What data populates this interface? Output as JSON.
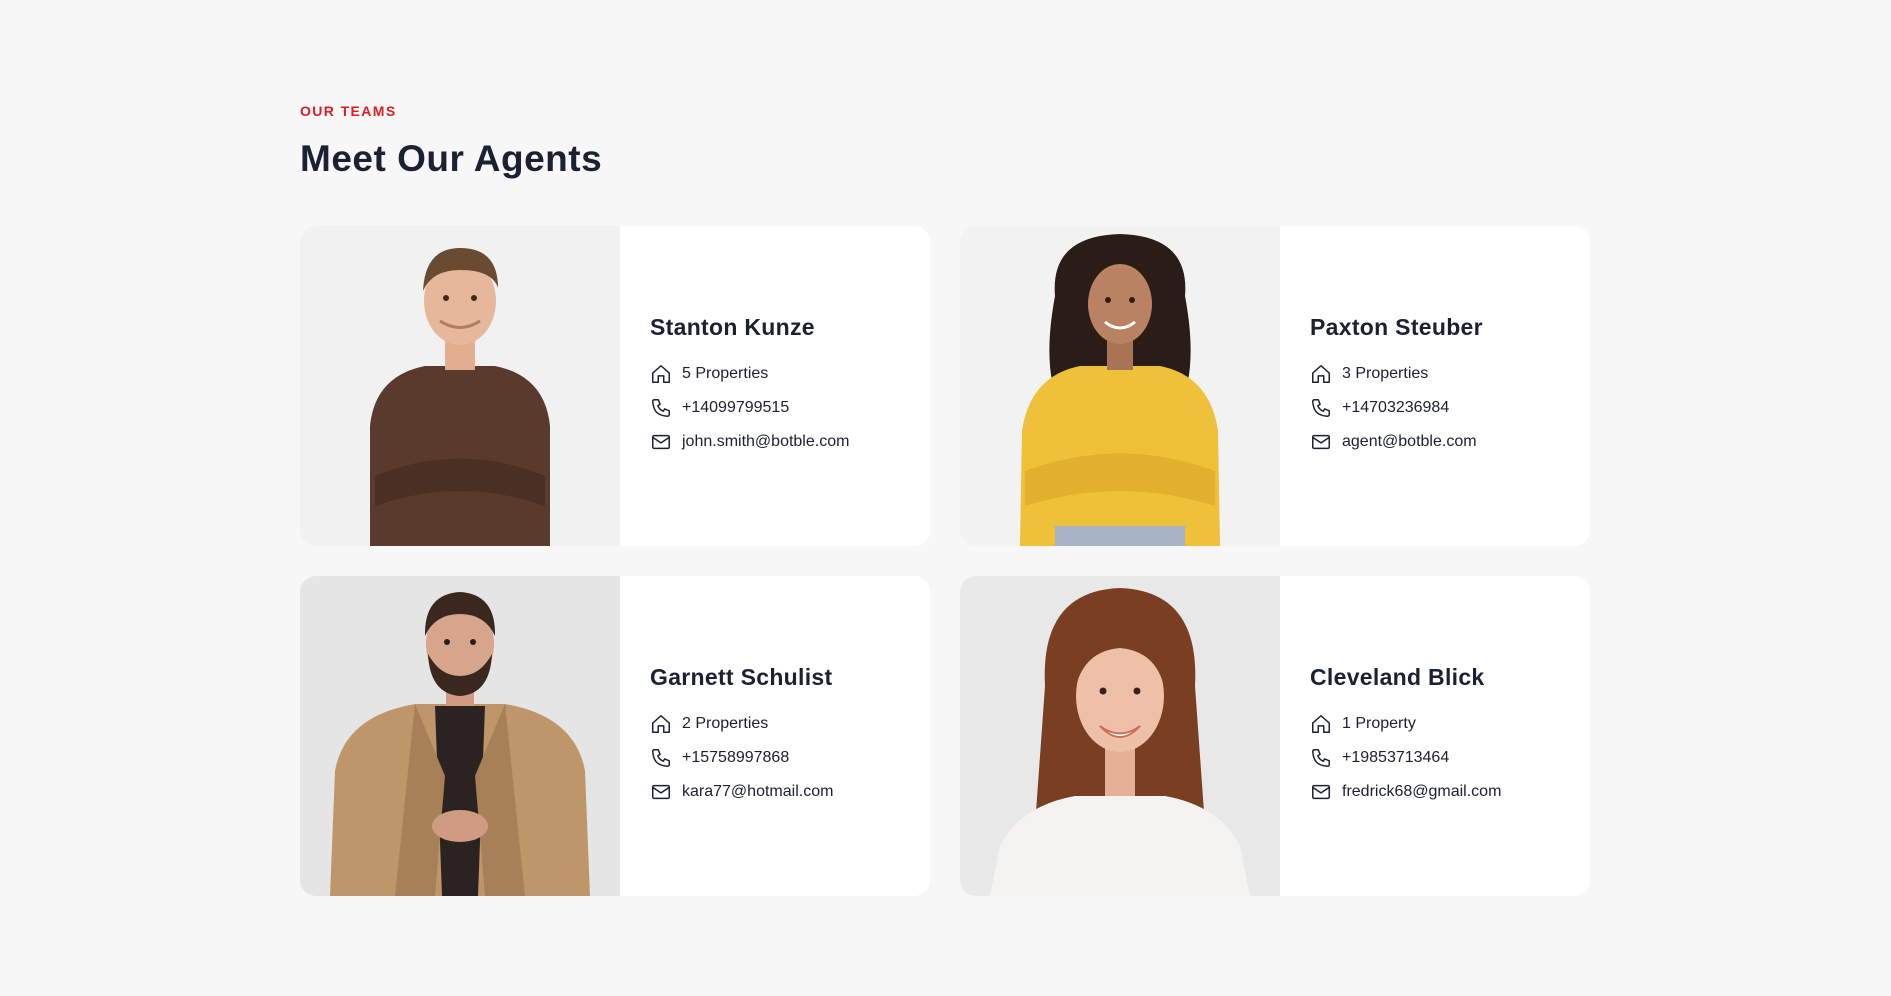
{
  "section": {
    "eyebrow": "OUR TEAMS",
    "title": "Meet Our Agents",
    "accent_color": "#db1d23",
    "text_color": "#1b2032"
  },
  "agents": [
    {
      "name": "Stanton Kunze",
      "properties": "5 Properties",
      "phone": "+14099799515",
      "email": "john.smith@botble.com",
      "photo_palette": {
        "bg": "#f1f1f1",
        "outfit": "#5a3a2c",
        "hair": "#6b4a32",
        "skin": "#e7b79c"
      }
    },
    {
      "name": "Paxton Steuber",
      "properties": "3 Properties",
      "phone": "+14703236984",
      "email": "agent@botble.com",
      "photo_palette": {
        "bg": "#f2f2f2",
        "outfit": "#efc03a",
        "hair": "#2a1d18",
        "skin": "#b98363"
      }
    },
    {
      "name": "Garnett Schulist",
      "properties": "2 Properties",
      "phone": "+15758997868",
      "email": "kara77@hotmail.com",
      "photo_palette": {
        "bg": "#e5e5e5",
        "outfit": "#bf966a",
        "hair": "#3a281e",
        "skin": "#d7a58c"
      }
    },
    {
      "name": "Cleveland Blick",
      "properties": "1 Property",
      "phone": "+19853713464",
      "email": "fredrick68@gmail.com",
      "photo_palette": {
        "bg": "#e8e8e8",
        "outfit": "#f5f3f1",
        "hair": "#7a3f22",
        "skin": "#eec0a8"
      }
    }
  ],
  "icons": {
    "properties": "home-icon",
    "phone": "phone-icon",
    "email": "mail-icon"
  }
}
